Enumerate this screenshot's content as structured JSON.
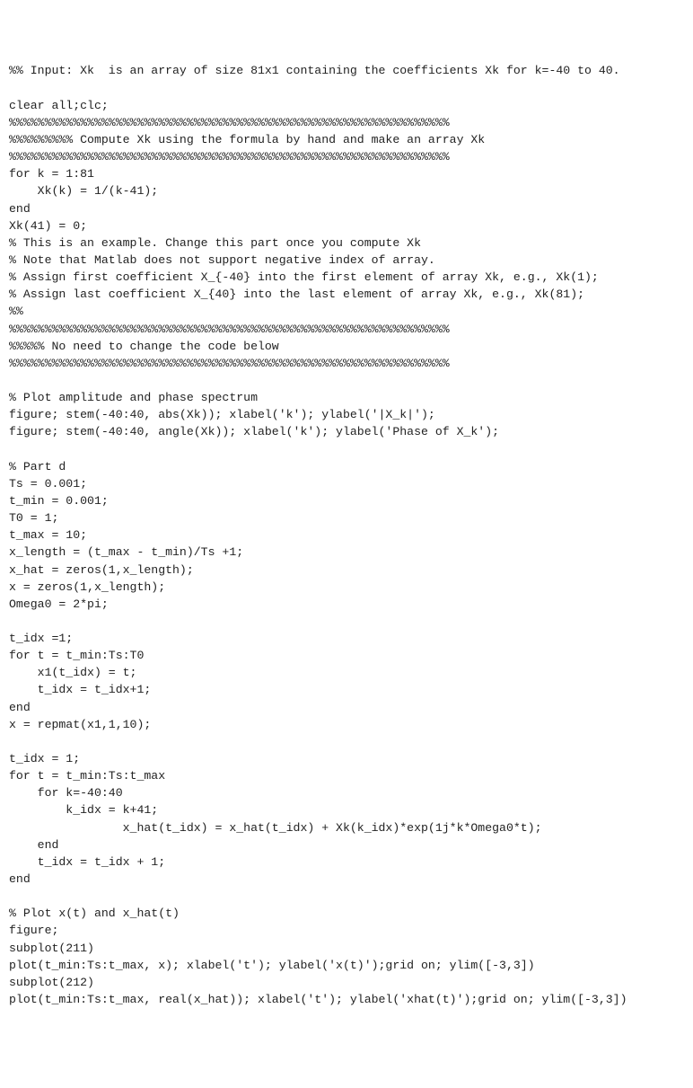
{
  "code_lines": [
    "%% Input: Xk  is an array of size 81x1 containing the coefficients Xk for k=-40 to 40.",
    "",
    "clear all;clc;",
    "%%%%%%%%%%%%%%%%%%%%%%%%%%%%%%%%%%%%%%%%%%%%%%%%%%%%%%%%%%%%%%",
    "%%%%%%%%% Compute Xk using the formula by hand and make an array Xk",
    "%%%%%%%%%%%%%%%%%%%%%%%%%%%%%%%%%%%%%%%%%%%%%%%%%%%%%%%%%%%%%%",
    "for k = 1:81",
    "    Xk(k) = 1/(k-41);",
    "end",
    "Xk(41) = 0;",
    "% This is an example. Change this part once you compute Xk",
    "% Note that Matlab does not support negative index of array.",
    "% Assign first coefficient X_{-40} into the first element of array Xk, e.g., Xk(1);",
    "% Assign last coefficient X_{40} into the last element of array Xk, e.g., Xk(81);",
    "%%",
    "%%%%%%%%%%%%%%%%%%%%%%%%%%%%%%%%%%%%%%%%%%%%%%%%%%%%%%%%%%%%%%",
    "%%%%% No need to change the code below",
    "%%%%%%%%%%%%%%%%%%%%%%%%%%%%%%%%%%%%%%%%%%%%%%%%%%%%%%%%%%%%%%",
    "",
    "% Plot amplitude and phase spectrum",
    "figure; stem(-40:40, abs(Xk)); xlabel('k'); ylabel('|X_k|');",
    "figure; stem(-40:40, angle(Xk)); xlabel('k'); ylabel('Phase of X_k');",
    "",
    "% Part d",
    "Ts = 0.001;",
    "t_min = 0.001;",
    "T0 = 1;",
    "t_max = 10;",
    "x_length = (t_max - t_min)/Ts +1;",
    "x_hat = zeros(1,x_length);",
    "x = zeros(1,x_length);",
    "Omega0 = 2*pi;",
    "",
    "t_idx =1;",
    "for t = t_min:Ts:T0",
    "    x1(t_idx) = t;",
    "    t_idx = t_idx+1;",
    "end",
    "x = repmat(x1,1,10);",
    "",
    "t_idx = 1;",
    "for t = t_min:Ts:t_max",
    "    for k=-40:40",
    "        k_idx = k+41;",
    "                x_hat(t_idx) = x_hat(t_idx) + Xk(k_idx)*exp(1j*k*Omega0*t);",
    "    end",
    "    t_idx = t_idx + 1;",
    "end",
    "",
    "% Plot x(t) and x_hat(t)",
    "figure;",
    "subplot(211)",
    "plot(t_min:Ts:t_max, x); xlabel('t'); ylabel('x(t)');grid on; ylim([-3,3])",
    "subplot(212)",
    "plot(t_min:Ts:t_max, real(x_hat)); xlabel('t'); ylabel('xhat(t)');grid on; ylim([-3,3])"
  ]
}
